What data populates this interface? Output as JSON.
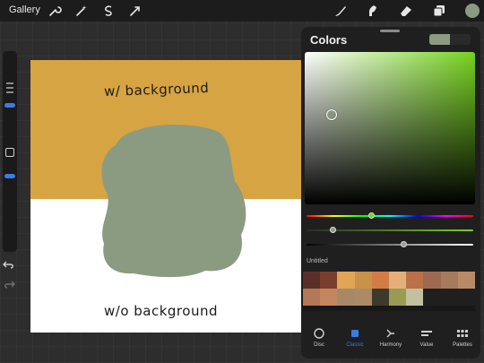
{
  "topbar": {
    "gallery_label": "Gallery",
    "icons": [
      "wrench-icon",
      "magic-wand-icon",
      "selection-icon",
      "transform-icon",
      "brush-icon",
      "smudge-icon",
      "eraser-icon",
      "layers-icon"
    ],
    "current_color": "#8a9b82"
  },
  "canvas": {
    "top_text": "w/ background",
    "bottom_text": "w/o background",
    "background_color": "#d7a443",
    "blob_color": "#8a9b82"
  },
  "colors_panel": {
    "title": "Colors",
    "current_color": "#8a9b82",
    "previous_color": "#2a2a2a",
    "hue_color": "#76d21e",
    "palette_name": "Untitled",
    "palette_swatches": [
      "#5a2f2a",
      "#7a3f2c",
      "#e1a556",
      "#c9914a",
      "#d27d46",
      "#e3b07c",
      "#b97145",
      "#9d6a4f",
      "#a77a5c",
      "#b98a66",
      "#b47758",
      "#c3865e",
      "#a88967",
      "#ad8a66",
      "#3d392d",
      "#9b9a52",
      "#c3c0a2",
      "#1f1f1f",
      "#1f1f1f",
      "#1f1f1f"
    ],
    "tabs": [
      {
        "label": "Disc",
        "icon": "disc-icon"
      },
      {
        "label": "Classic",
        "icon": "classic-square-icon"
      },
      {
        "label": "Harmony",
        "icon": "harmony-icon"
      },
      {
        "label": "Value",
        "icon": "value-sliders-icon"
      },
      {
        "label": "Palettes",
        "icon": "palettes-grid-icon"
      }
    ],
    "active_tab": "Classic"
  }
}
